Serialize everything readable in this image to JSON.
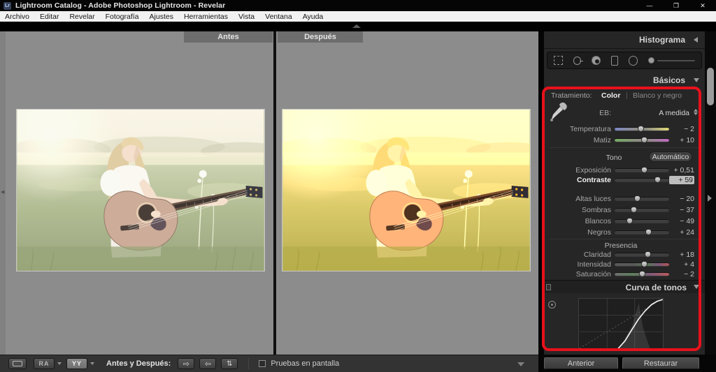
{
  "titlebar": {
    "logo": "Lr",
    "title": "Lightroom Catalog - Adobe Photoshop Lightroom - Revelar",
    "minimize": "—",
    "restore": "❐",
    "close": "✕"
  },
  "menubar": {
    "items": [
      "Archivo",
      "Editar",
      "Revelar",
      "Fotografía",
      "Ajustes",
      "Herramientas",
      "Vista",
      "Ventana",
      "Ayuda"
    ]
  },
  "compare": {
    "before": "Antes",
    "after": "Después"
  },
  "panel": {
    "histogram_title": "Histograma",
    "basics_title": "Básicos",
    "treatment_label": "Tratamiento:",
    "treatment_color": "Color",
    "treatment_separator": "|",
    "treatment_bw": "Blanco y negro",
    "wb_label": "EB:",
    "wb_value": "A medida",
    "tone_label": "Tono",
    "auto_button": "Automático",
    "presence_label": "Presencia",
    "curve_title": "Curva de tonos",
    "sliders": [
      {
        "label": "Temperatura",
        "value": "− 2",
        "percent": 47,
        "type": "temp"
      },
      {
        "label": "Matiz",
        "value": "+ 10",
        "percent": 54,
        "type": "tint"
      },
      {
        "label": "Exposición",
        "value": "+ 0,51",
        "percent": 54,
        "type": "neutral"
      },
      {
        "label": "Contraste",
        "value": "+ 59",
        "percent": 78,
        "type": "neutral",
        "highlighted": true
      },
      {
        "label": "Altas luces",
        "value": "− 20",
        "percent": 41,
        "type": "neutral"
      },
      {
        "label": "Sombras",
        "value": "− 37",
        "percent": 35,
        "type": "neutral"
      },
      {
        "label": "Blancos",
        "value": "− 49",
        "percent": 27,
        "type": "neutral"
      },
      {
        "label": "Negros",
        "value": "+ 24",
        "percent": 61,
        "type": "neutral"
      },
      {
        "label": "Claridad",
        "value": "+ 18",
        "percent": 60,
        "type": "neutral"
      },
      {
        "label": "Intensidad",
        "value": "+ 4",
        "percent": 54,
        "type": "vibrance"
      },
      {
        "label": "Saturación",
        "value": "− 2",
        "percent": 50,
        "type": "saturation"
      }
    ],
    "tone_curve": {
      "points": [
        [
          0.47,
          1.0
        ],
        [
          0.55,
          0.85
        ],
        [
          0.63,
          0.63
        ],
        [
          0.71,
          0.42
        ],
        [
          0.79,
          0.25
        ],
        [
          0.87,
          0.12
        ],
        [
          0.94,
          0.05
        ],
        [
          1.0,
          0.02
        ]
      ]
    }
  },
  "toolbar": {
    "before_after_label": "Antes y Después:",
    "copy_right": "⇨",
    "copy_left": "⇦",
    "swap": "⇅",
    "view_ra": "RA",
    "view_yy": "YY",
    "soft_proof_label": "Pruebas en pantalla"
  },
  "footer_buttons": {
    "previous": "Anterior",
    "reset": "Restaurar"
  },
  "colors": {
    "highlight_red": "#e8111c",
    "accent_panel_bg": "#262626",
    "workspace_gray": "#8c8c8c"
  }
}
